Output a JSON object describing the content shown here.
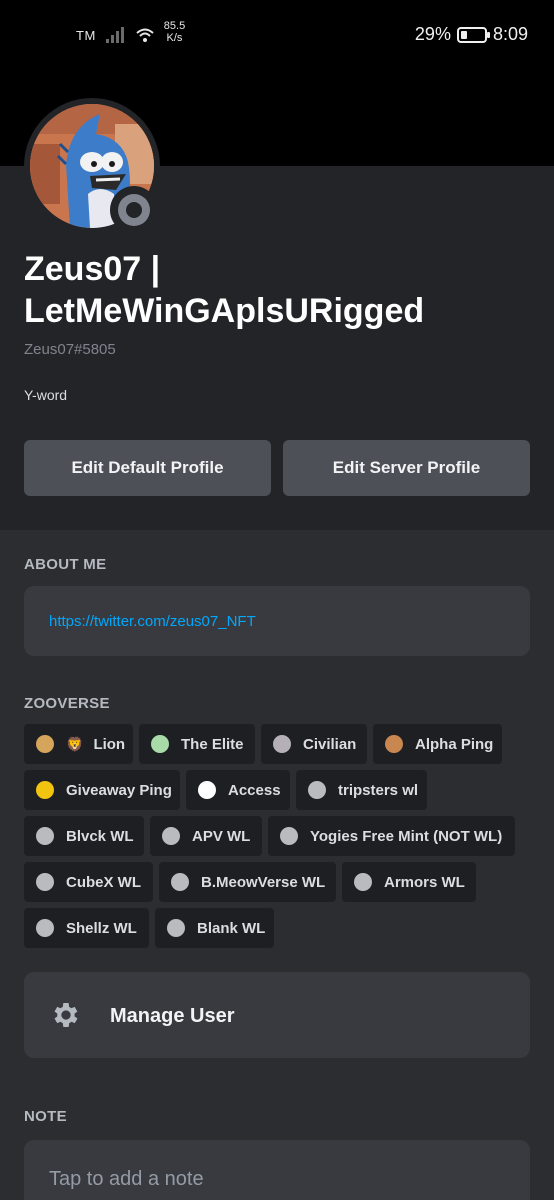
{
  "status_bar": {
    "carrier": "TM",
    "network_speed_value": "85.5",
    "network_speed_unit": "K/s",
    "battery_percent": "29%",
    "battery_level": 0.29,
    "time": "8:09"
  },
  "profile": {
    "display_name": "Zeus07 | LetMeWinGAplsURigged",
    "tag": "Zeus07#5805",
    "custom_status": "Y-word",
    "presence": "offline"
  },
  "buttons": {
    "edit_default": "Edit Default Profile",
    "edit_server": "Edit Server Profile"
  },
  "about_me": {
    "title": "ABOUT ME",
    "link": "https://twitter.com/zeus07_NFT"
  },
  "roles": {
    "title": "ZOOVERSE",
    "items": [
      {
        "label": "Lion",
        "color": "#d4a55a",
        "emoji": "🦁"
      },
      {
        "label": "The Elite",
        "color": "#a8dba8"
      },
      {
        "label": "Civilian",
        "color": "#b5b0b8"
      },
      {
        "label": "Alpha Ping",
        "color": "#c88650"
      },
      {
        "label": "Giveaway Ping",
        "color": "#f1c40f"
      },
      {
        "label": "Access",
        "color": "#ffffff"
      },
      {
        "label": "tripsters wl",
        "color": "#b9bbbe"
      },
      {
        "label": "Blvck WL",
        "color": "#b9bbbe"
      },
      {
        "label": "APV WL",
        "color": "#b9bbbe"
      },
      {
        "label": "Yogies Free Mint (NOT WL)",
        "color": "#b9bbbe"
      },
      {
        "label": "CubeX WL",
        "color": "#b9bbbe"
      },
      {
        "label": "B.MeowVerse WL",
        "color": "#b9bbbe"
      },
      {
        "label": "Armors WL",
        "color": "#b9bbbe"
      },
      {
        "label": "Shellz WL",
        "color": "#b9bbbe"
      },
      {
        "label": "Blank WL",
        "color": "#b9bbbe"
      }
    ]
  },
  "manage_user": {
    "label": "Manage User",
    "icon": "gear-icon"
  },
  "note": {
    "title": "NOTE",
    "placeholder": "Tap to add a note"
  }
}
